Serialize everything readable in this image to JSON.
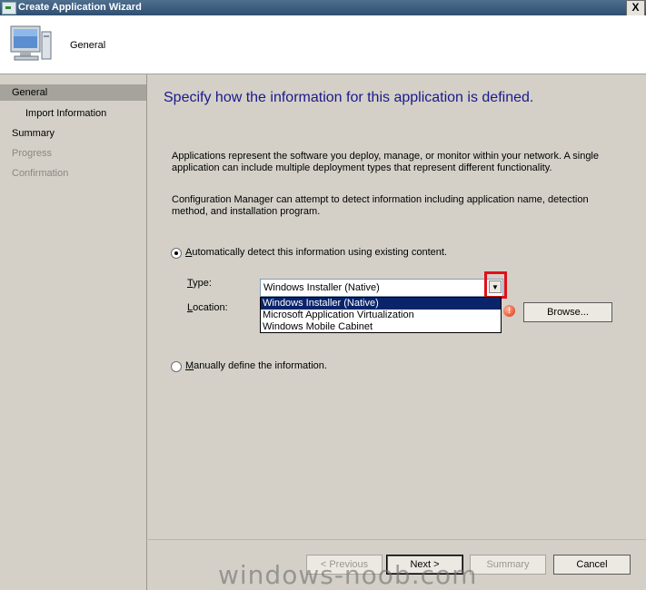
{
  "window": {
    "title": "Create Application Wizard",
    "close_label": "X"
  },
  "header": {
    "title": "General",
    "icon": "computer-monitor-icon"
  },
  "nav": {
    "items": [
      {
        "label": "General",
        "state": "active"
      },
      {
        "label": "Import Information",
        "state": "normal"
      },
      {
        "label": "Summary",
        "state": "normal"
      },
      {
        "label": "Progress",
        "state": "disabled"
      },
      {
        "label": "Confirmation",
        "state": "disabled"
      }
    ]
  },
  "main": {
    "heading": "Specify how the information for this application is defined.",
    "paragraph1": "Applications represent the software you deploy, manage, or monitor within your network. A single application can include multiple deployment types that represent different functionality.",
    "paragraph2": "Configuration Manager can attempt to detect information including application name, detection method, and installation program.",
    "auto_option": {
      "label_prefix": "A",
      "label_rest": "utomatically detect this information using existing content.",
      "checked": true
    },
    "type_label_prefix": "T",
    "type_label_rest": "ype:",
    "location_label_prefix": "L",
    "location_label_rest": "ocation:",
    "type_combo": {
      "value": "Windows Installer (Native)",
      "options": [
        "Windows Installer (Native)",
        "Microsoft Application Virtualization",
        "Windows Mobile Cabinet"
      ],
      "selected_index": 0
    },
    "browse_label": "Browse...",
    "manual_option": {
      "label_prefix": "M",
      "label_rest": "anually define the information.",
      "checked": false
    }
  },
  "footer": {
    "previous_label": "< Previous",
    "next_label": "Next >",
    "summary_label": "Summary",
    "cancel_label": "Cancel"
  },
  "watermark": "windows-noob.com",
  "colors": {
    "heading": "#1a1a8a",
    "highlight": "#e0101a",
    "selection": "#0a246a"
  }
}
